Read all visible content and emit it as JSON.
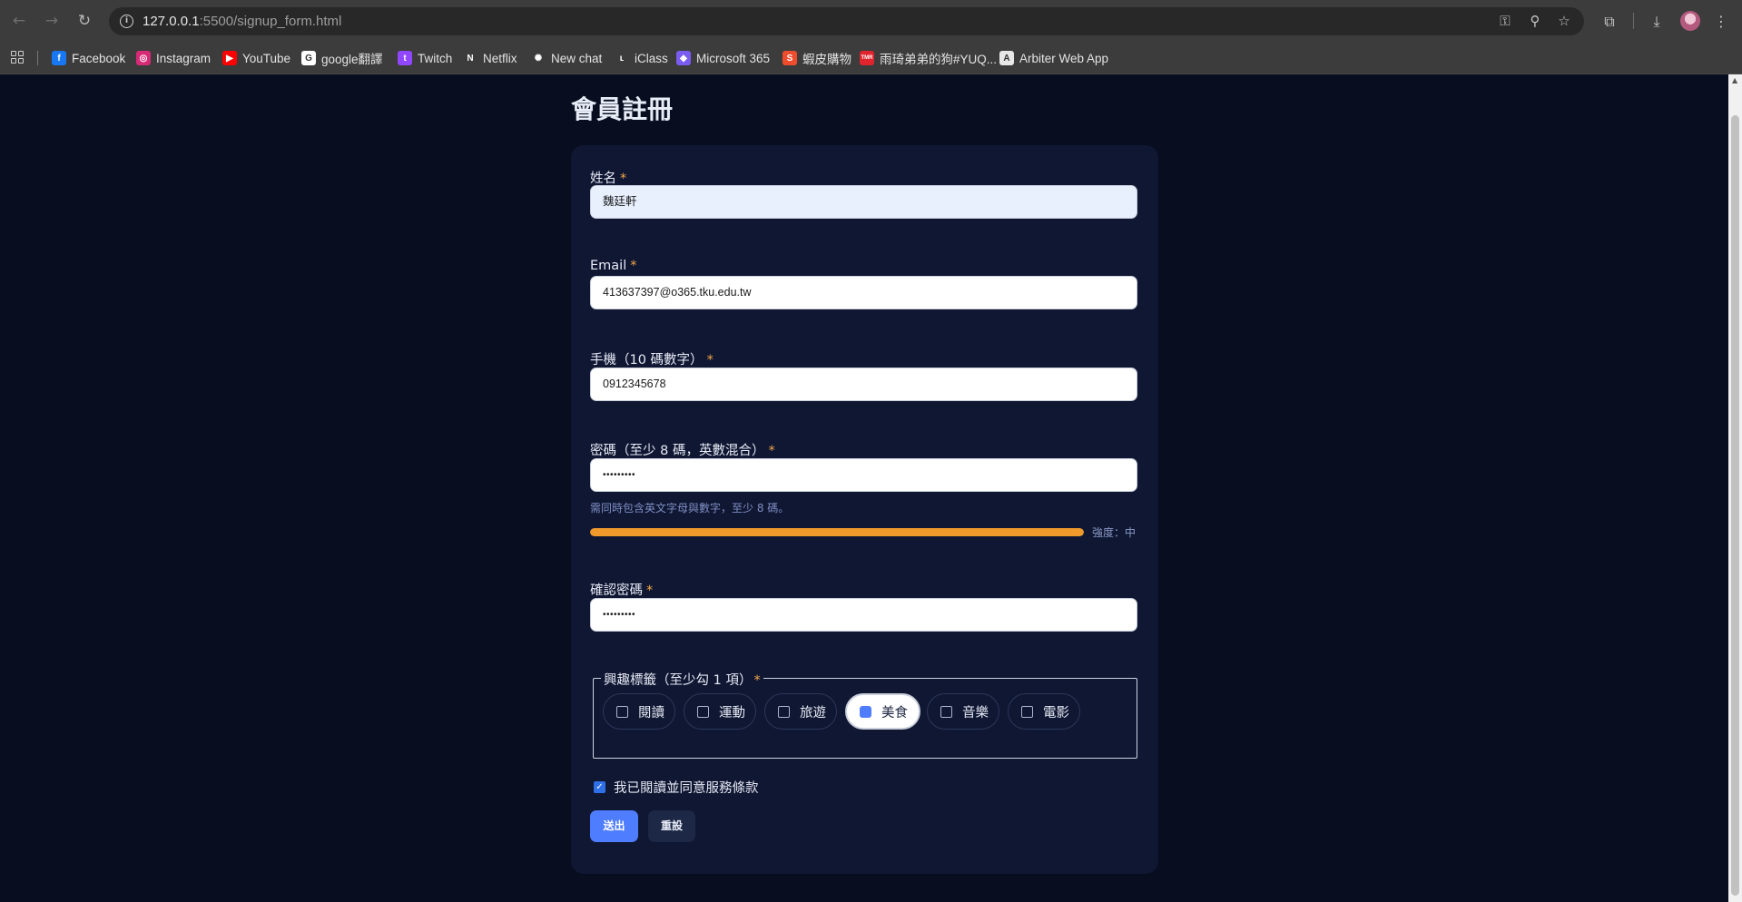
{
  "browser": {
    "url_host": "127.0.0.1",
    "url_path": ":5500/signup_form.html",
    "bookmarks": [
      {
        "label": "Facebook",
        "icon": "facebook-icon",
        "color": "#1877f2",
        "glyph": "f"
      },
      {
        "label": "Instagram",
        "icon": "instagram-icon",
        "color": "#d62976",
        "glyph": "◎"
      },
      {
        "label": "YouTube",
        "icon": "youtube-icon",
        "color": "#ff0000",
        "glyph": "▶"
      },
      {
        "label": "google翻譯",
        "icon": "google-icon",
        "color": "#ffffff",
        "glyph": "G"
      },
      {
        "label": "Twitch",
        "icon": "twitch-icon",
        "color": "#9146ff",
        "glyph": "t"
      },
      {
        "label": "Netflix",
        "icon": "netflix-icon",
        "color": "#3c3c3c",
        "glyph": "N"
      },
      {
        "label": "New chat",
        "icon": "chatgpt-icon",
        "color": "#3c3c3c",
        "glyph": "✺"
      },
      {
        "label": "iClass",
        "icon": "iclass-icon",
        "color": "#3c3c3c",
        "glyph": "ʟ"
      },
      {
        "label": "Microsoft 365",
        "icon": "microsoft-365-icon",
        "color": "#7b5cf0",
        "glyph": "◆"
      },
      {
        "label": "蝦皮購物",
        "icon": "shopee-icon",
        "color": "#ee4d2d",
        "glyph": "S"
      },
      {
        "label": "雨琦弟弟的狗#YUQ...",
        "icon": "tmr-icon",
        "color": "#e0242d",
        "glyph": "TMR"
      },
      {
        "label": "Arbiter Web App",
        "icon": "arbiter-icon",
        "color": "#e8e8e8",
        "glyph": "A"
      }
    ]
  },
  "page": {
    "title": "會員註冊"
  },
  "form": {
    "required_mark": "*",
    "name": {
      "label": "姓名",
      "value": "魏廷軒"
    },
    "email": {
      "label": "Email",
      "value": "413637397@o365.tku.edu.tw"
    },
    "phone": {
      "label": "手機（10 碼數字）",
      "value": "0912345678"
    },
    "password": {
      "label": "密碼（至少 8 碼，英數混合）",
      "value": "•••••••••",
      "hint": "需同時包含英文字母與數字，至少 8 碼。",
      "strength_fraction": 1.0,
      "strength_text": "強度：中"
    },
    "confirm": {
      "label": "確認密碼",
      "value": "•••••••••"
    },
    "interests": {
      "legend": "興趣標籤（至少勾 1 項）",
      "options": [
        {
          "label": "閱讀",
          "checked": false
        },
        {
          "label": "運動",
          "checked": false
        },
        {
          "label": "旅遊",
          "checked": false
        },
        {
          "label": "美食",
          "checked": true
        },
        {
          "label": "音樂",
          "checked": false
        },
        {
          "label": "電影",
          "checked": false
        }
      ]
    },
    "terms": {
      "label": "我已閱讀並同意服務條款",
      "checked": true
    },
    "submit_label": "送出",
    "reset_label": "重設"
  },
  "colors": {
    "page_bg": "#080e1f",
    "card_bg": "#0f1732",
    "accent": "#4f7dff",
    "required": "#f4a64a",
    "strength": "#f19a2c"
  }
}
